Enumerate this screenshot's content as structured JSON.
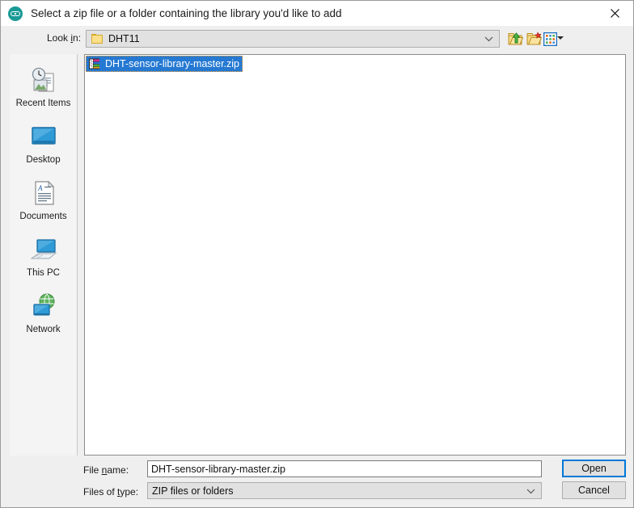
{
  "window": {
    "title": "Select a zip file or a folder containing the library you'd like to add",
    "app_icon": "arduino-logo-icon",
    "close_icon": "close-icon",
    "accent_color": "#0078d7",
    "selection_color": "#2579d2",
    "icon_color": "#1a9a96"
  },
  "lookin": {
    "label_pre": "Look ",
    "label_mnemonic": "i",
    "label_post": "n:",
    "value": "DHT11",
    "folder_icon": "folder-icon",
    "dropdown_icon": "chevron-down-icon"
  },
  "toolbar": {
    "up_one_level": "up-one-level-icon",
    "new_folder": "new-folder-icon",
    "view_menu": "view-list-icon",
    "view_menu_arrow": "triangle-down-icon"
  },
  "sidebar": {
    "items": [
      {
        "label": "Recent Items",
        "icon": "recent-items-icon"
      },
      {
        "label": "Desktop",
        "icon": "desktop-icon"
      },
      {
        "label": "Documents",
        "icon": "documents-icon"
      },
      {
        "label": "This PC",
        "icon": "this-pc-icon"
      },
      {
        "label": "Network",
        "icon": "network-icon"
      }
    ]
  },
  "filelist": {
    "items": [
      {
        "name": "DHT-sensor-library-master.zip",
        "icon": "zip-archive-icon",
        "selected": true
      }
    ]
  },
  "form": {
    "filename_label_pre": "File ",
    "filename_label_mnemonic": "n",
    "filename_label_post": "ame:",
    "filename_value": "DHT-sensor-library-master.zip",
    "filename_placeholder": "",
    "filetype_label_pre": "Files of ",
    "filetype_label_mnemonic": "t",
    "filetype_label_post": "ype:",
    "filetype_value": "ZIP files or folders",
    "filetype_dropdown_icon": "chevron-down-icon"
  },
  "buttons": {
    "open": "Open",
    "cancel": "Cancel"
  }
}
